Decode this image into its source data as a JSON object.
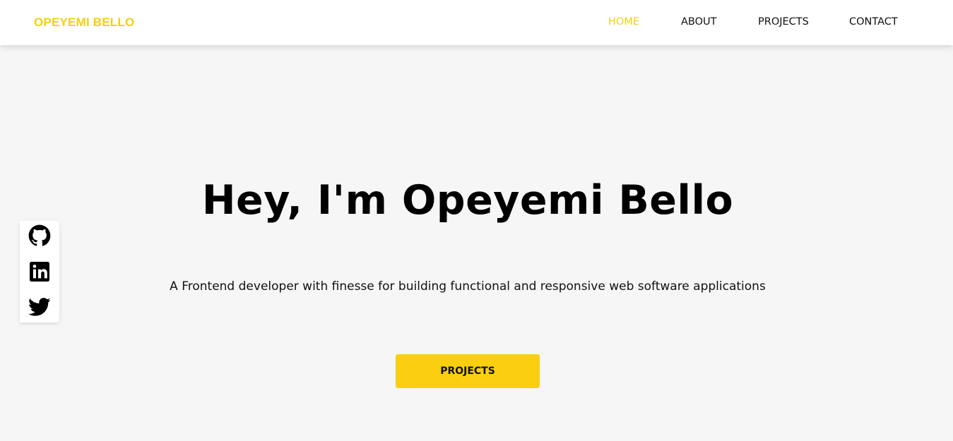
{
  "header": {
    "brand": "OPEYEMI BELLO",
    "nav": [
      {
        "label": "HOME",
        "active": true
      },
      {
        "label": "ABOUT",
        "active": false
      },
      {
        "label": "PROJECTS",
        "active": false
      },
      {
        "label": "CONTACT",
        "active": false
      }
    ]
  },
  "hero": {
    "title": "Hey, I'm Opeyemi Bello",
    "subtitle": "A Frontend developer with finesse for building functional and responsive web software applications",
    "button_label": "PROJECTS"
  },
  "social": [
    {
      "icon": "github-icon"
    },
    {
      "icon": "linkedin-icon"
    },
    {
      "icon": "twitter-icon"
    }
  ],
  "colors": {
    "accent": "#f6cf0e",
    "background": "#f6f6f6",
    "header_bg": "#ffffff",
    "text": "#111111"
  }
}
